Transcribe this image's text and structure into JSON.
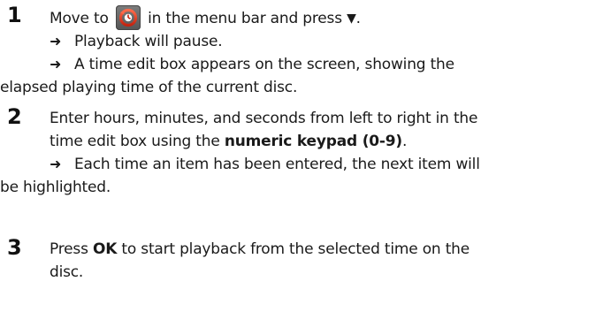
{
  "steps": [
    {
      "number": "1",
      "lines": {
        "a_pre": "Move to",
        "a_post": "in the menu bar and press",
        "a_arrow": "▼",
        "a_end": ".",
        "r1": "Playback will pause.",
        "r2a": "A time edit box appears on the screen, showing the",
        "r2b": "elapsed playing time of the current disc."
      },
      "icon": "time-search-icon"
    },
    {
      "number": "2",
      "lines": {
        "a": "Enter hours, minutes, and seconds from left to right in the",
        "b_pre": "time edit box using the",
        "b_bold": "numeric keypad (0-9)",
        "b_end": ".",
        "r1a": "Each time an item has been entered, the next item will",
        "r1b": "be highlighted."
      }
    },
    {
      "number": "3",
      "lines": {
        "a_pre": "Press",
        "a_bold": "OK",
        "a_post": "to start playback from the selected time on the",
        "b": "disc."
      }
    }
  ],
  "result_arrow": "➜"
}
